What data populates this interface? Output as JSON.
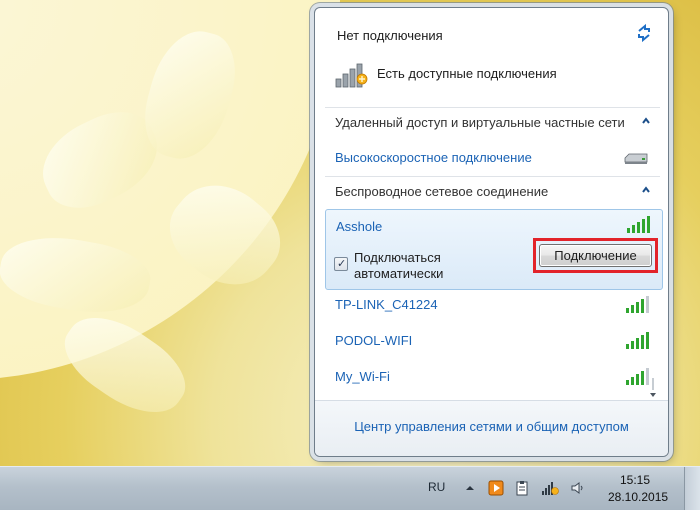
{
  "popup": {
    "status_title": "Нет подключения",
    "available_label": "Есть доступные подключения",
    "sections": {
      "vpn_header": "Удаленный доступ и виртуальные частные сети",
      "vpn_item": "Высокоскоростное подключение",
      "wireless_header": "Беспроводное сетевое соединение"
    },
    "selected_network": {
      "name": "Asshole",
      "auto_connect_label_line1": "Подключаться",
      "auto_connect_label_line2": "автоматически",
      "auto_connect_checked": true,
      "connect_button": "Подключение"
    },
    "networks": [
      {
        "name": "TP-LINK_C41224"
      },
      {
        "name": "PODOL-WIFI"
      },
      {
        "name": "My_Wi-Fi"
      }
    ],
    "footer_link": "Центр управления сетями и общим доступом"
  },
  "taskbar": {
    "language": "RU",
    "time": "15:15",
    "date": "28.10.2015"
  },
  "colors": {
    "link": "#1b63b5",
    "highlight_outline": "#e2232a",
    "signal_green": "#2fa52f"
  },
  "icons": [
    "refresh-icon",
    "network-signal-warning-icon",
    "collapse-chevron-icon",
    "dialup-modem-icon",
    "wifi-signal-icon"
  ]
}
